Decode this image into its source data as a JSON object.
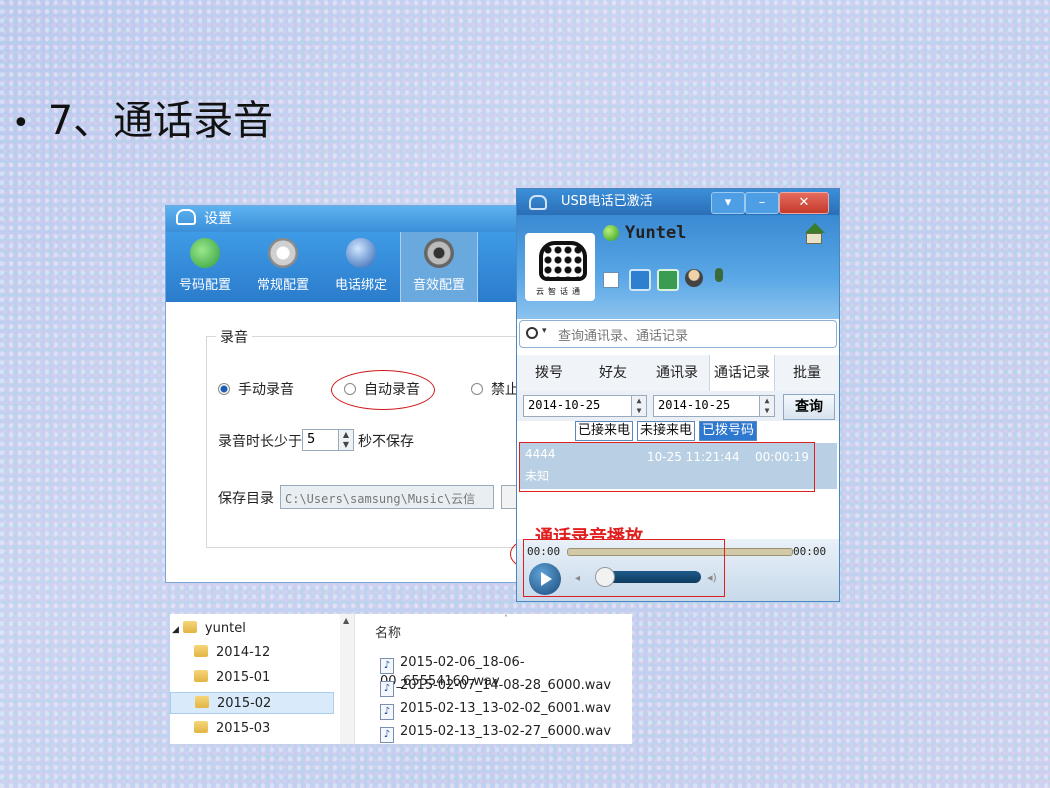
{
  "slide": {
    "bullet": "•",
    "title": "7、通话录音"
  },
  "settings_window": {
    "title": "设置",
    "tabs": [
      {
        "label": "号码配置",
        "icon": "phone-globe-icon"
      },
      {
        "label": "常规配置",
        "icon": "gear-icon"
      },
      {
        "label": "电话绑定",
        "icon": "globe-icon"
      },
      {
        "label": "音效配置",
        "icon": "speaker-icon"
      }
    ],
    "section_title": "录音",
    "options": [
      "手动录音",
      "自动录音",
      "禁止"
    ],
    "selected_option": "手动录音",
    "duration_label_pre": "录音时长少于",
    "duration_value": "5",
    "duration_label_post": "秒不保存",
    "save_dir_label": "保存目录",
    "save_dir_value": "C:\\Users\\samsung\\Music\\云信"
  },
  "phone_window": {
    "title": "USB电话已激活",
    "brand": "Yuntel",
    "logo_text": "云智话通",
    "search_placeholder": "查询通讯录、通话记录",
    "tabs": [
      "拨号",
      "好友",
      "通讯录",
      "通话记录",
      "批量"
    ],
    "active_tab": "通话记录",
    "date_from": "2014-10-25",
    "date_to": "2014-10-25",
    "query_button": "查询",
    "filters": [
      "已接来电",
      "未接来电",
      "已拨号码"
    ],
    "active_filter": "已拨号码",
    "record": {
      "number": "4444",
      "name": "未知",
      "time": "10-25 11:21:44",
      "duration": "00:00:19"
    },
    "annotation": "通话录音播放",
    "player": {
      "current": "00:00",
      "total": "00:00"
    }
  },
  "explorer": {
    "root": "yuntel",
    "folders": [
      "2014-12",
      "2015-01",
      "2015-02",
      "2015-03"
    ],
    "selected_folder": "2015-02",
    "column_header": "名称",
    "files": [
      "2015-02-06_18-06-00_65554160.wav",
      "2015-02-07_14-08-28_6000.wav",
      "2015-02-13_13-02-02_6001.wav",
      "2015-02-13_13-02-27_6000.wav"
    ]
  },
  "colors": {
    "annotation_red": "#e02020",
    "window_blue": "#3a8fd9"
  }
}
